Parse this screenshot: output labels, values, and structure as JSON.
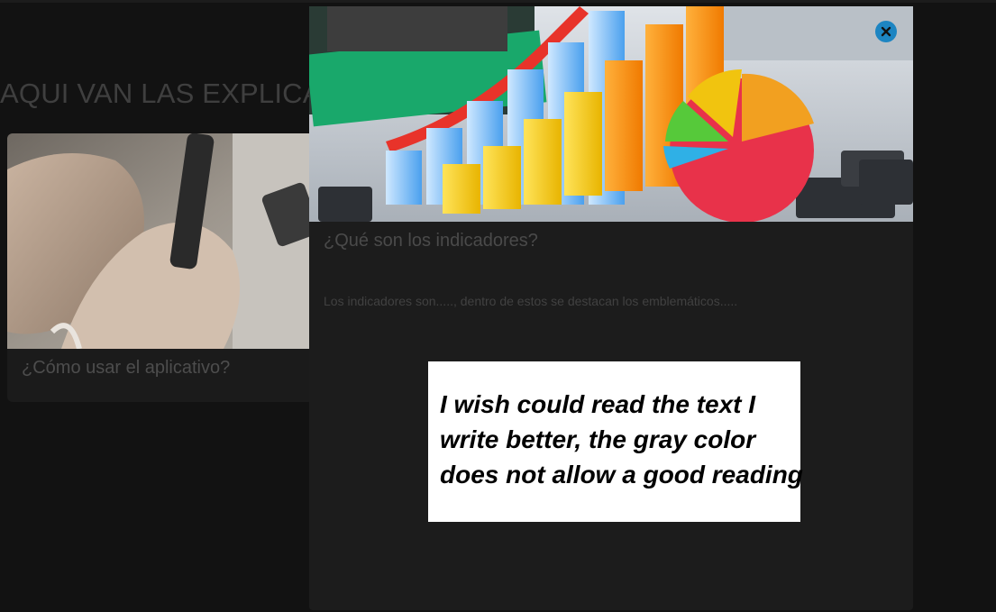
{
  "page": {
    "heading": "AQUI VAN LAS EXPLICAC"
  },
  "card": {
    "title": "¿Cómo usar el aplicativo?",
    "image": "hands-holding-smartphone-photo"
  },
  "modal": {
    "title": "¿Qué son los indicadores?",
    "body": "Los indicadores son....., dentro de estos se destacan los emblemáticos.....",
    "image": "3d-bar-and-pie-chart-on-keyboard-photo",
    "close_icon": "close-icon",
    "accent": "#1d85c2"
  },
  "note": {
    "line1": "I wish could read the text I",
    "line2": "write better, the gray color",
    "line3": "does not allow a good reading"
  },
  "colors": {
    "background": "#121212",
    "card": "#1b1b1b",
    "modal": "#1c1c1c",
    "muted_text": "#4a4a4a"
  }
}
